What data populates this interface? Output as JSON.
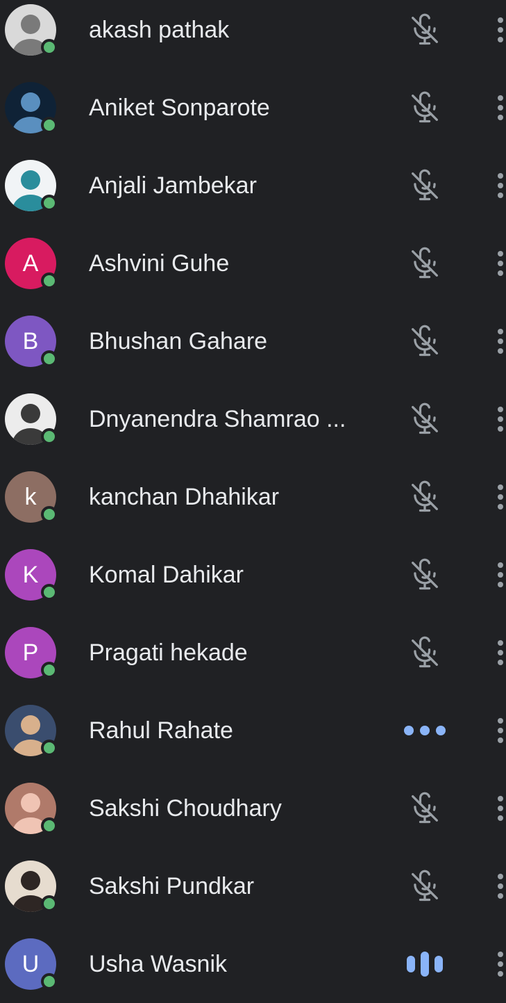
{
  "colors": {
    "background": "#202124",
    "text": "#e8eaed",
    "online": "#5bb974",
    "muted_icon": "#9aa0a6",
    "accent": "#8ab4f8"
  },
  "participants": [
    {
      "name": "akash pathak",
      "avatar": {
        "type": "photo",
        "bg": "#d9d9d9",
        "fg": "#7a7a7a"
      },
      "status_icon": "mic-off-icon",
      "online": true
    },
    {
      "name": "Aniket Sonparote",
      "avatar": {
        "type": "photo",
        "bg": "#0f2236",
        "fg": "#5a8fbf"
      },
      "status_icon": "mic-off-icon",
      "online": true
    },
    {
      "name": "Anjali Jambekar",
      "avatar": {
        "type": "photo",
        "bg": "#f1f4f6",
        "fg": "#2a8d9c"
      },
      "status_icon": "mic-off-icon",
      "online": true
    },
    {
      "name": "Ashvini Guhe",
      "avatar": {
        "type": "initial",
        "letter": "A",
        "bg": "#d81b60"
      },
      "status_icon": "mic-off-icon",
      "online": true
    },
    {
      "name": "Bhushan Gahare",
      "avatar": {
        "type": "initial",
        "letter": "B",
        "bg": "#7e57c2"
      },
      "status_icon": "mic-off-icon",
      "online": true
    },
    {
      "name": "Dnyanendra Shamrao ...",
      "avatar": {
        "type": "photo",
        "bg": "#ececec",
        "fg": "#3a3a3a"
      },
      "status_icon": "mic-off-icon",
      "online": true
    },
    {
      "name": "kanchan Dhahikar",
      "avatar": {
        "type": "initial",
        "letter": "k",
        "bg": "#8d6e63"
      },
      "status_icon": "mic-off-icon",
      "online": true
    },
    {
      "name": "Komal Dahikar",
      "avatar": {
        "type": "initial",
        "letter": "K",
        "bg": "#ab47bc"
      },
      "status_icon": "mic-off-icon",
      "online": true
    },
    {
      "name": "Pragati hekade",
      "avatar": {
        "type": "initial",
        "letter": "P",
        "bg": "#ab47bc"
      },
      "status_icon": "mic-off-icon",
      "online": true
    },
    {
      "name": "Rahul Rahate",
      "avatar": {
        "type": "photo",
        "bg": "#3a4d6e",
        "fg": "#d8b08c"
      },
      "status_icon": "ellipsis-icon",
      "online": true
    },
    {
      "name": "Sakshi Choudhary",
      "avatar": {
        "type": "photo",
        "bg": "#b07a6a",
        "fg": "#f0c4b4"
      },
      "status_icon": "mic-off-icon",
      "online": true
    },
    {
      "name": "Sakshi Pundkar",
      "avatar": {
        "type": "photo",
        "bg": "#e6dccf",
        "fg": "#2e2624"
      },
      "status_icon": "mic-off-icon",
      "online": true
    },
    {
      "name": "Usha Wasnik",
      "avatar": {
        "type": "initial",
        "letter": "U",
        "bg": "#5c6bc0"
      },
      "status_icon": "speaking-icon",
      "online": true
    }
  ]
}
